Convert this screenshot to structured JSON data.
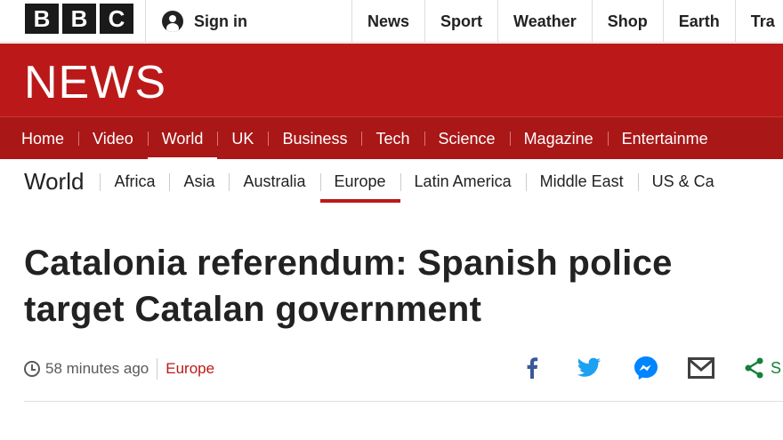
{
  "masthead": {
    "logo_letters": [
      "B",
      "B",
      "C"
    ],
    "signin_label": "Sign in",
    "top_links": [
      "News",
      "Sport",
      "Weather",
      "Shop",
      "Earth",
      "Tra"
    ]
  },
  "banner": {
    "title": "NEWS",
    "color": "#bb1919"
  },
  "main_nav": {
    "items": [
      "Home",
      "Video",
      "World",
      "UK",
      "Business",
      "Tech",
      "Science",
      "Magazine",
      "Entertainme"
    ],
    "active": "World"
  },
  "section_nav": {
    "title": "World",
    "items": [
      "Africa",
      "Asia",
      "Australia",
      "Europe",
      "Latin America",
      "Middle East",
      "US & Ca"
    ],
    "active": "Europe",
    "accent": "#bb1919"
  },
  "article": {
    "headline_line1": "Catalonia referendum: Spanish police",
    "headline_line2": "target Catalan government",
    "timestamp": "58 minutes ago",
    "section": "Europe"
  },
  "share": {
    "icons": [
      "facebook-icon",
      "twitter-icon",
      "messenger-icon",
      "email-icon",
      "share-icon"
    ],
    "label": "S",
    "colors": {
      "facebook": "#3b5998",
      "twitter": "#1da1f2",
      "messenger": "#0084ff",
      "email": "#404040",
      "share": "#15803a"
    }
  }
}
